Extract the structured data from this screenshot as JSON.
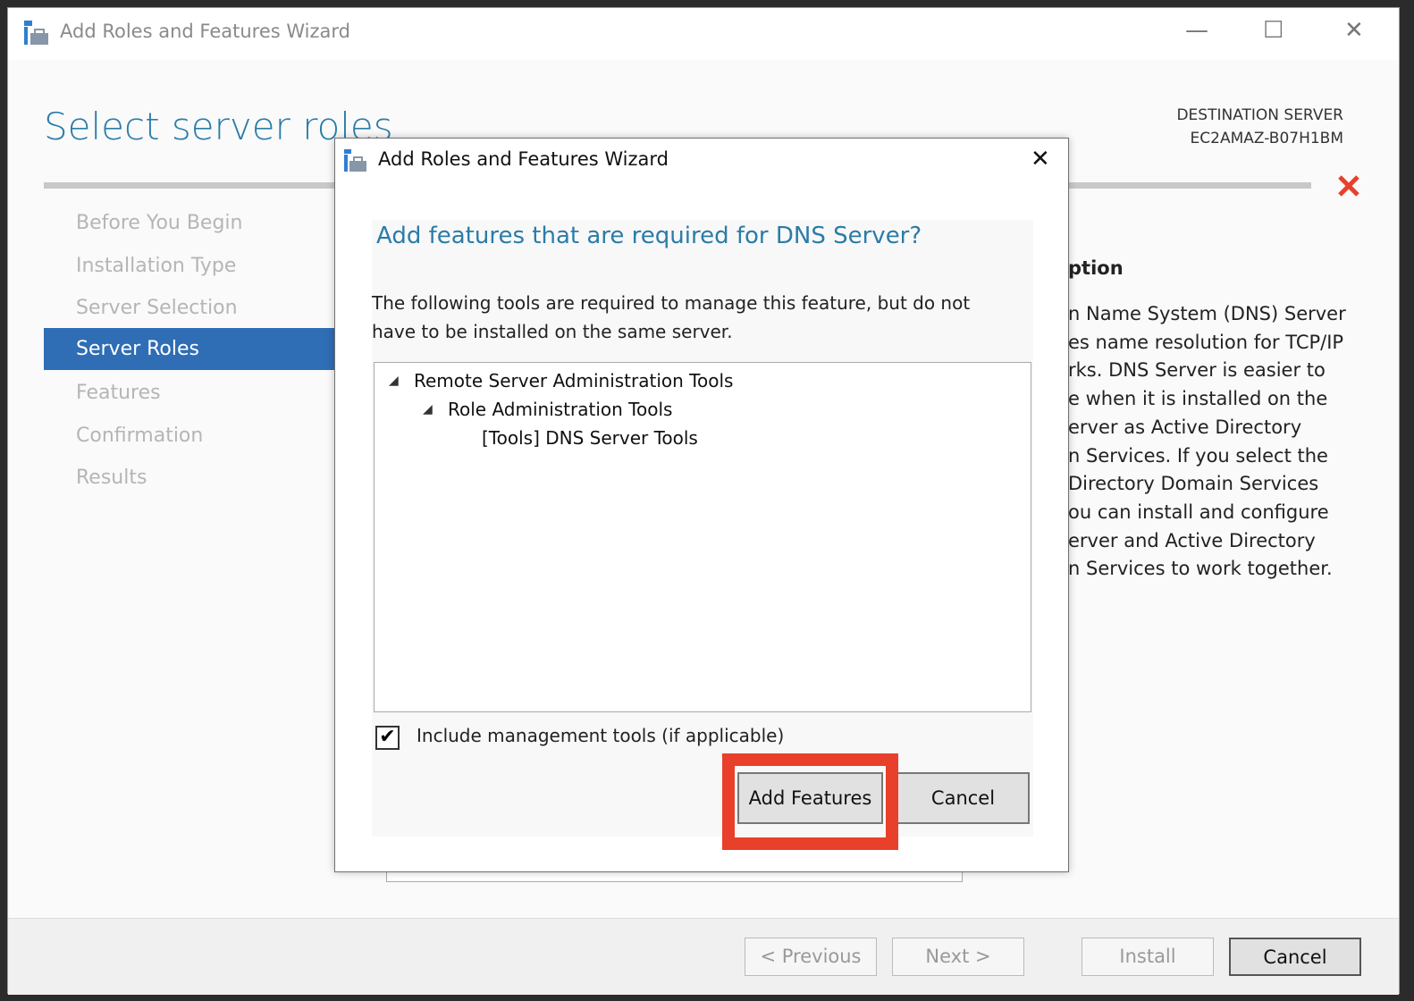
{
  "window": {
    "title": "Add Roles and Features Wizard",
    "minimize": "—",
    "maximize": "☐",
    "close": "✕"
  },
  "page": {
    "heading": "Select server roles",
    "destination_label": "DESTINATION SERVER",
    "destination_server": "EC2AMAZ-B07H1BM",
    "error_icon": "red-x-icon",
    "error_color": "#e8402a"
  },
  "nav": [
    {
      "label": "Before You Begin"
    },
    {
      "label": "Installation Type"
    },
    {
      "label": "Server Selection"
    },
    {
      "label": "Server Roles",
      "selected": true
    },
    {
      "label": "Features"
    },
    {
      "label": "Confirmation"
    },
    {
      "label": "Results"
    }
  ],
  "description": {
    "title_fragment": "ption",
    "lines": [
      "n Name System (DNS) Server",
      "es name resolution for TCP/IP",
      "rks. DNS Server is easier to",
      "e when it is installed on the",
      "erver as Active Directory",
      "n Services. If you select the",
      "Directory Domain Services",
      "ou can install and configure",
      "erver and Active Directory",
      "n Services to work together."
    ]
  },
  "footer": {
    "previous": "< Previous",
    "next": "Next >",
    "install": "Install",
    "cancel": "Cancel"
  },
  "dialog": {
    "title": "Add Roles and Features Wizard",
    "close": "✕",
    "heading": "Add features that are required for DNS Server?",
    "text": "The following tools are required to manage this feature, but do not have to be installed on the same server.",
    "tree": [
      {
        "label": "Remote Server Administration Tools",
        "expanded": true
      },
      {
        "label": "Role Administration Tools",
        "expanded": true
      },
      {
        "label": "[Tools] DNS Server Tools"
      }
    ],
    "include_tools_label": "Include management tools (if applicable)",
    "include_tools_checked": true,
    "add_features": "Add Features",
    "cancel": "Cancel"
  },
  "highlight_color": "#e8402a"
}
